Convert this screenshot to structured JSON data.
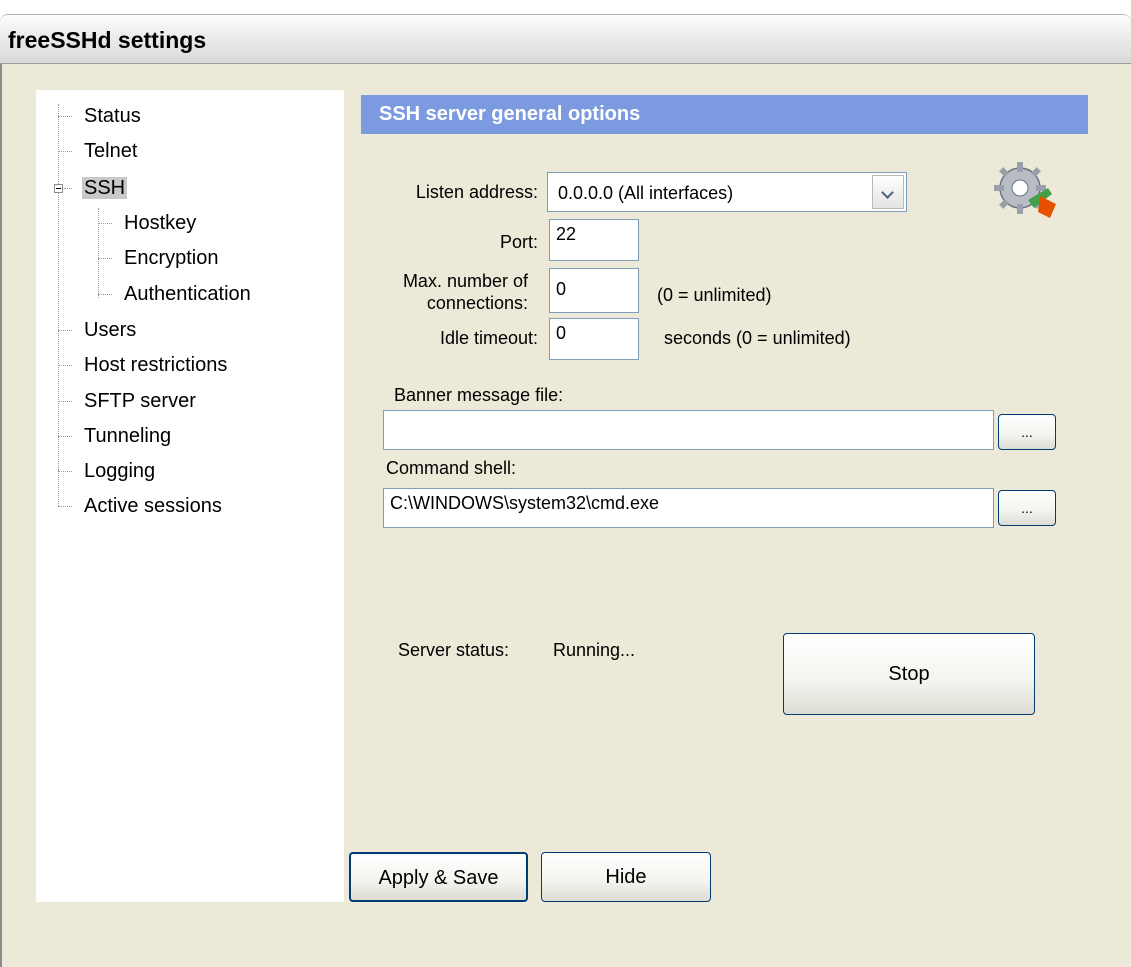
{
  "window": {
    "title": "freeSSHd settings"
  },
  "tree": {
    "items": [
      {
        "label": "Status"
      },
      {
        "label": "Telnet"
      },
      {
        "label": "SSH"
      },
      {
        "label": "Hostkey"
      },
      {
        "label": "Encryption"
      },
      {
        "label": "Authentication"
      },
      {
        "label": "Users"
      },
      {
        "label": "Host restrictions"
      },
      {
        "label": "SFTP server"
      },
      {
        "label": "Tunneling"
      },
      {
        "label": "Logging"
      },
      {
        "label": "Active sessions"
      }
    ],
    "selected": "SSH"
  },
  "panel": {
    "header": "SSH server general options",
    "listen_address_label": "Listen address:",
    "listen_address_value": "0.0.0.0 (All interfaces)",
    "port_label": "Port:",
    "port_value": "22",
    "max_conn_label_1": "Max. number of",
    "max_conn_label_2": "connections:",
    "max_conn_value": "0",
    "max_conn_hint": "(0 = unlimited)",
    "idle_label": "Idle timeout:",
    "idle_value": "0",
    "idle_hint": "seconds (0 = unlimited)",
    "banner_label": "Banner message file:",
    "banner_value": "",
    "browse_label": "...",
    "shell_label": "Command shell:",
    "shell_value": "C:\\WINDOWS\\system32\\cmd.exe",
    "status_label": "Server status:",
    "status_value": "Running...",
    "stop_label": "Stop",
    "settings_icon": "gear-refresh-icon"
  },
  "footer": {
    "apply_label": "Apply & Save",
    "hide_label": "Hide"
  },
  "colors": {
    "header_bg": "#7b9ae0",
    "dialog_bg": "#ece9d8",
    "button_border": "#003c74"
  }
}
